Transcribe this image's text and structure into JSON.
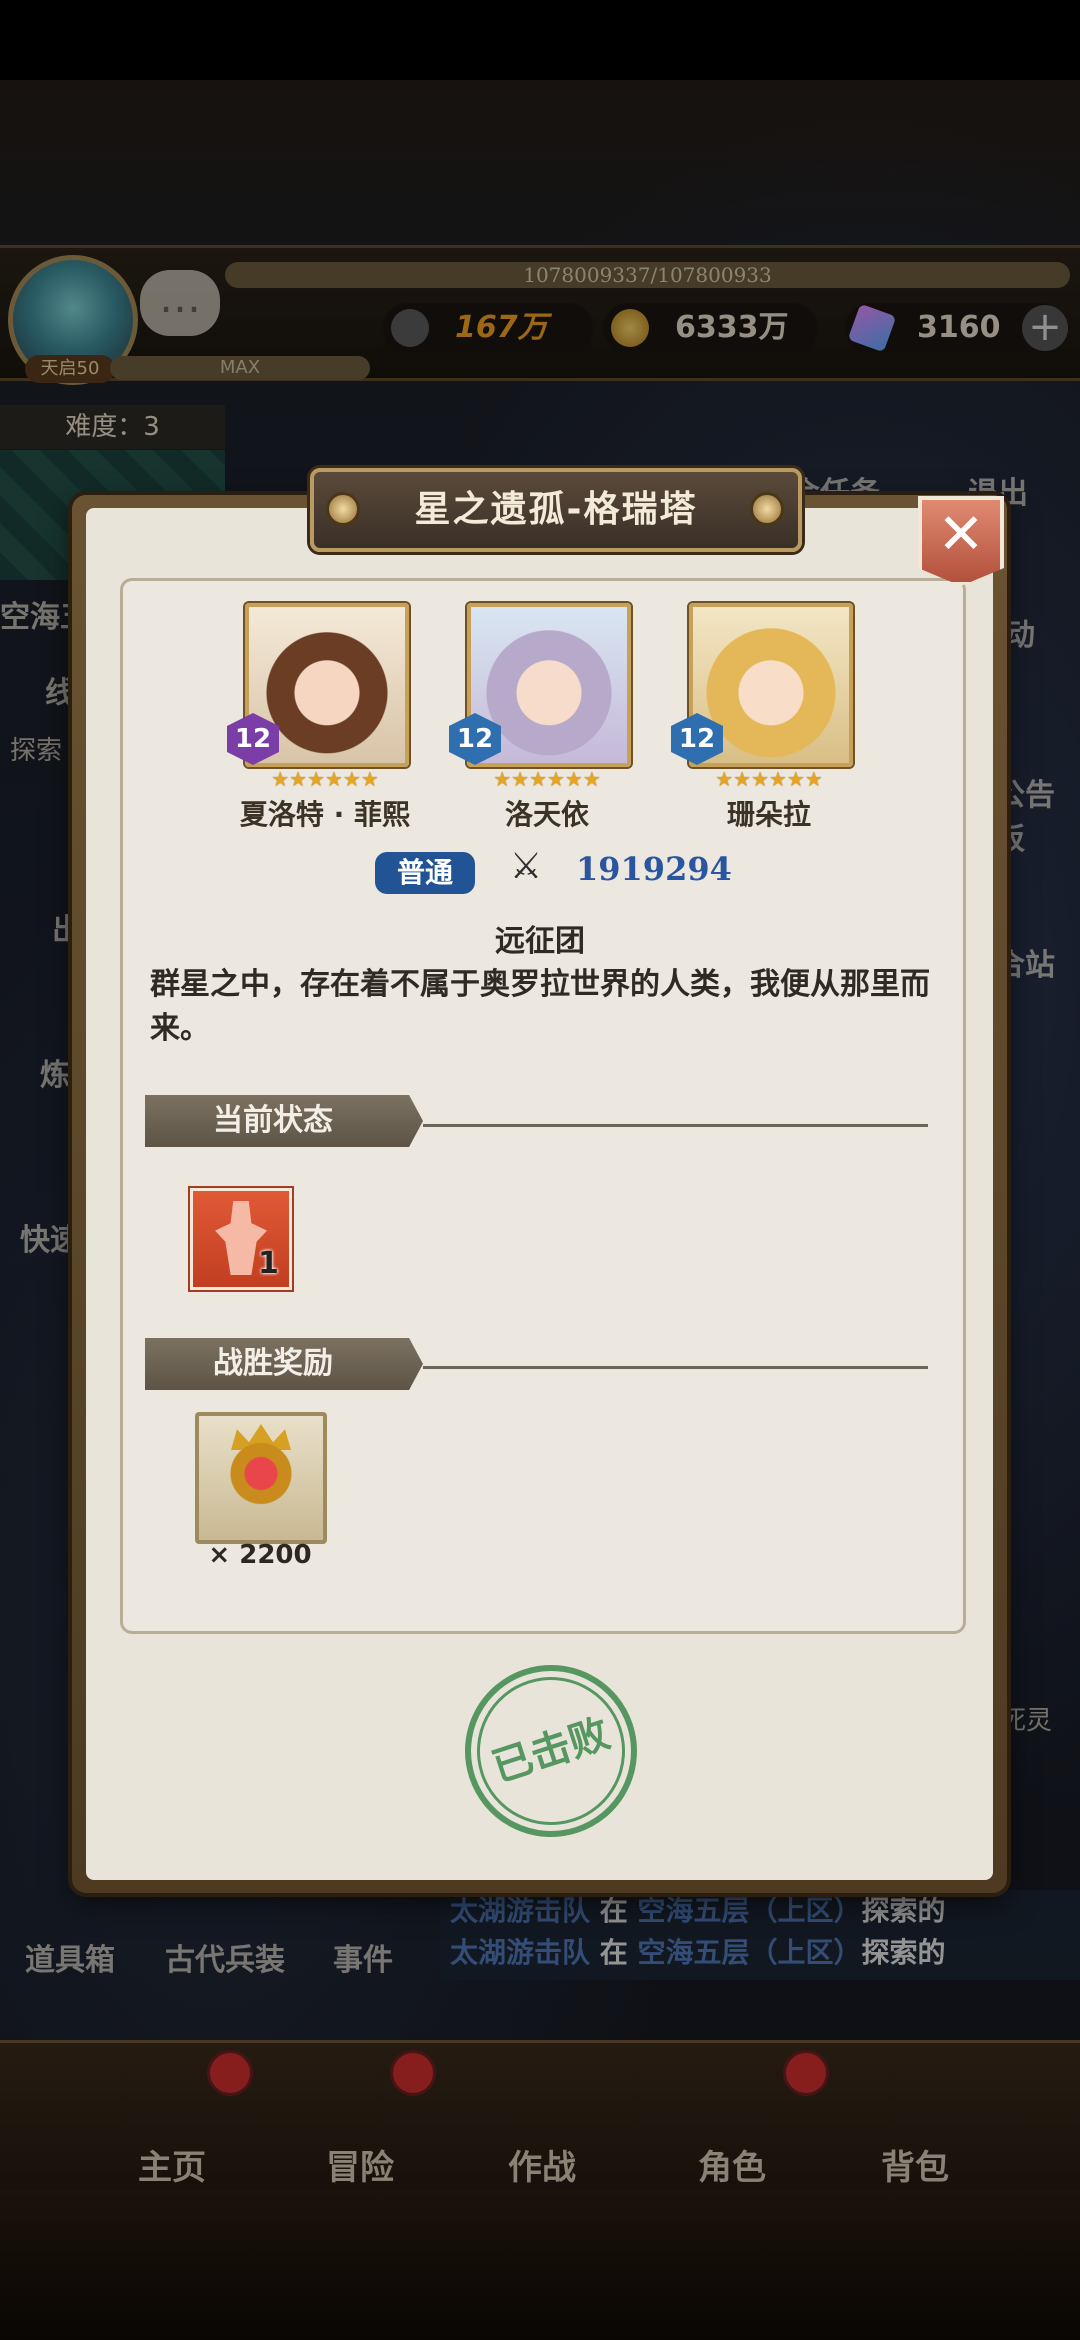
{
  "hud": {
    "avatar_level": "天启50",
    "hp_value": "1078009337/107800933",
    "exp_label": "MAX",
    "power": "167万",
    "gold": "6333万",
    "gems": "3160",
    "difficulty": "难度：3"
  },
  "background": {
    "left_labels": [
      "空海五",
      "线",
      "探索",
      "出",
      "炼",
      "快速"
    ],
    "right_labels": [
      "会任务",
      "退出",
      "动",
      "公告板",
      "合站",
      "死灵"
    ],
    "bottom_shortcuts": [
      "道具箱",
      "古代兵装",
      "事件"
    ],
    "marquee_lines": [
      {
        "team": "太湖游击队",
        "mid": "在",
        "place": "空海五层（上区）",
        "tail": "探索的"
      },
      {
        "team": "太湖游击队",
        "mid": "在",
        "place": "空海五层（上区）",
        "tail": "探索的"
      }
    ],
    "nav": [
      "主页",
      "冒险",
      "作战",
      "角色",
      "背包"
    ]
  },
  "modal": {
    "title": "星之遗孤-格瑞塔",
    "close_icon": "close-icon",
    "heroes": [
      {
        "name": "夏洛特 · 菲熙",
        "level": "12",
        "stars": "★★★★★★",
        "badge_color": "#7a3ea6"
      },
      {
        "name": "洛天依",
        "level": "12",
        "stars": "★★★★★★",
        "badge_color": "#2f6fb0"
      },
      {
        "name": "珊朵拉",
        "level": "12",
        "stars": "★★★★★★",
        "badge_color": "#2f6fb0"
      }
    ],
    "type_tag": "普通",
    "power_value": "1919294",
    "team_name": "远征团",
    "description": "群星之中，存在着不属于奥罗拉世界的人类，我便从那里而来。",
    "status_section": "当前状态",
    "status_count": "1",
    "reward_section": "战胜奖励",
    "reward_count": "× 2200",
    "stamp": "已击败"
  },
  "colors": {
    "accent_blue": "#225394",
    "power_blue": "#2a55a0",
    "stamp_green": "#3d8a4c",
    "star_gold": "#e7a622"
  }
}
